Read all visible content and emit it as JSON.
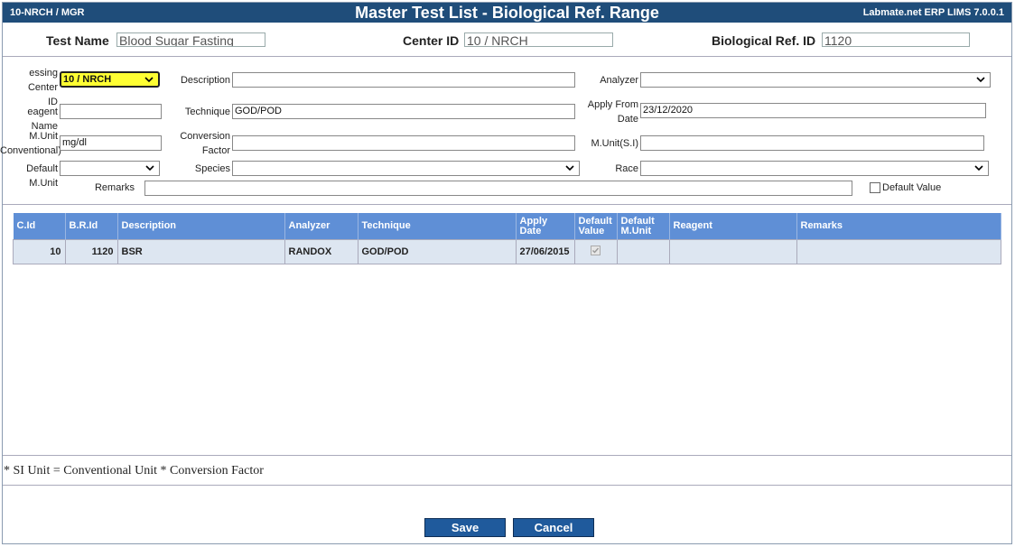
{
  "titlebar": {
    "left": "10-NRCH / MGR",
    "title": "Master Test List - Biological Ref. Range",
    "right": "Labmate.net ERP LIMS 7.0.0.1"
  },
  "header": {
    "test_name_label": "Test Name",
    "test_name_value": "Blood Sugar Fasting",
    "center_id_label": "Center ID",
    "center_id_value": "10 / NRCH",
    "bio_ref_label": "Biological Ref. ID",
    "bio_ref_value": "1120"
  },
  "form": {
    "processing_center_label_1": "essing Center",
    "processing_center_label_2": "ID",
    "processing_center_value": "10 / NRCH",
    "description_label": "Description",
    "description_value": "",
    "analyzer_label": "Analyzer",
    "analyzer_value": "",
    "reagent_label": "eagent Name",
    "reagent_value": "",
    "technique_label": "Technique",
    "technique_value": "GOD/POD",
    "apply_from_label_1": "Apply From",
    "apply_from_label_2": "Date",
    "apply_from_value": "23/12/2020",
    "munit_conv_label_1": "M.Unit",
    "munit_conv_label_2": "Conventional)",
    "munit_conv_value": "mg/dl",
    "conv_factor_label_1": "Conversion",
    "conv_factor_label_2": "Factor",
    "conv_factor_value": "",
    "munit_si_label": "M.Unit(S.I)",
    "munit_si_value": "",
    "default_munit_label": "Default M.Unit",
    "default_munit_value": "",
    "species_label": "Species",
    "species_value": "",
    "race_label": "Race",
    "race_value": "",
    "remarks_label": "Remarks",
    "remarks_value": "",
    "default_value_label": "Default Value"
  },
  "grid": {
    "headers": [
      "C.Id",
      "B.R.Id",
      "Description",
      "Analyzer",
      "Technique",
      "Apply Date",
      "Default Value",
      "Default M.Unit",
      "Reagent",
      "Remarks"
    ],
    "rows": [
      {
        "cid": "10",
        "brid": "1120",
        "description": "BSR",
        "analyzer": "RANDOX",
        "technique": "GOD/POD",
        "apply_date": "27/06/2015",
        "default_value": "checked",
        "default_munit": "",
        "reagent": "",
        "remarks": ""
      }
    ]
  },
  "footnote": "* SI Unit = Conventional Unit * Conversion Factor",
  "buttons": {
    "save": "Save",
    "cancel": "Cancel"
  },
  "colors": {
    "titlebar": "#1f4d7a",
    "grid_header": "#5f8fd6",
    "grid_row": "#dde6f1",
    "button": "#1f5a9c",
    "highlight": "#ffff33"
  }
}
